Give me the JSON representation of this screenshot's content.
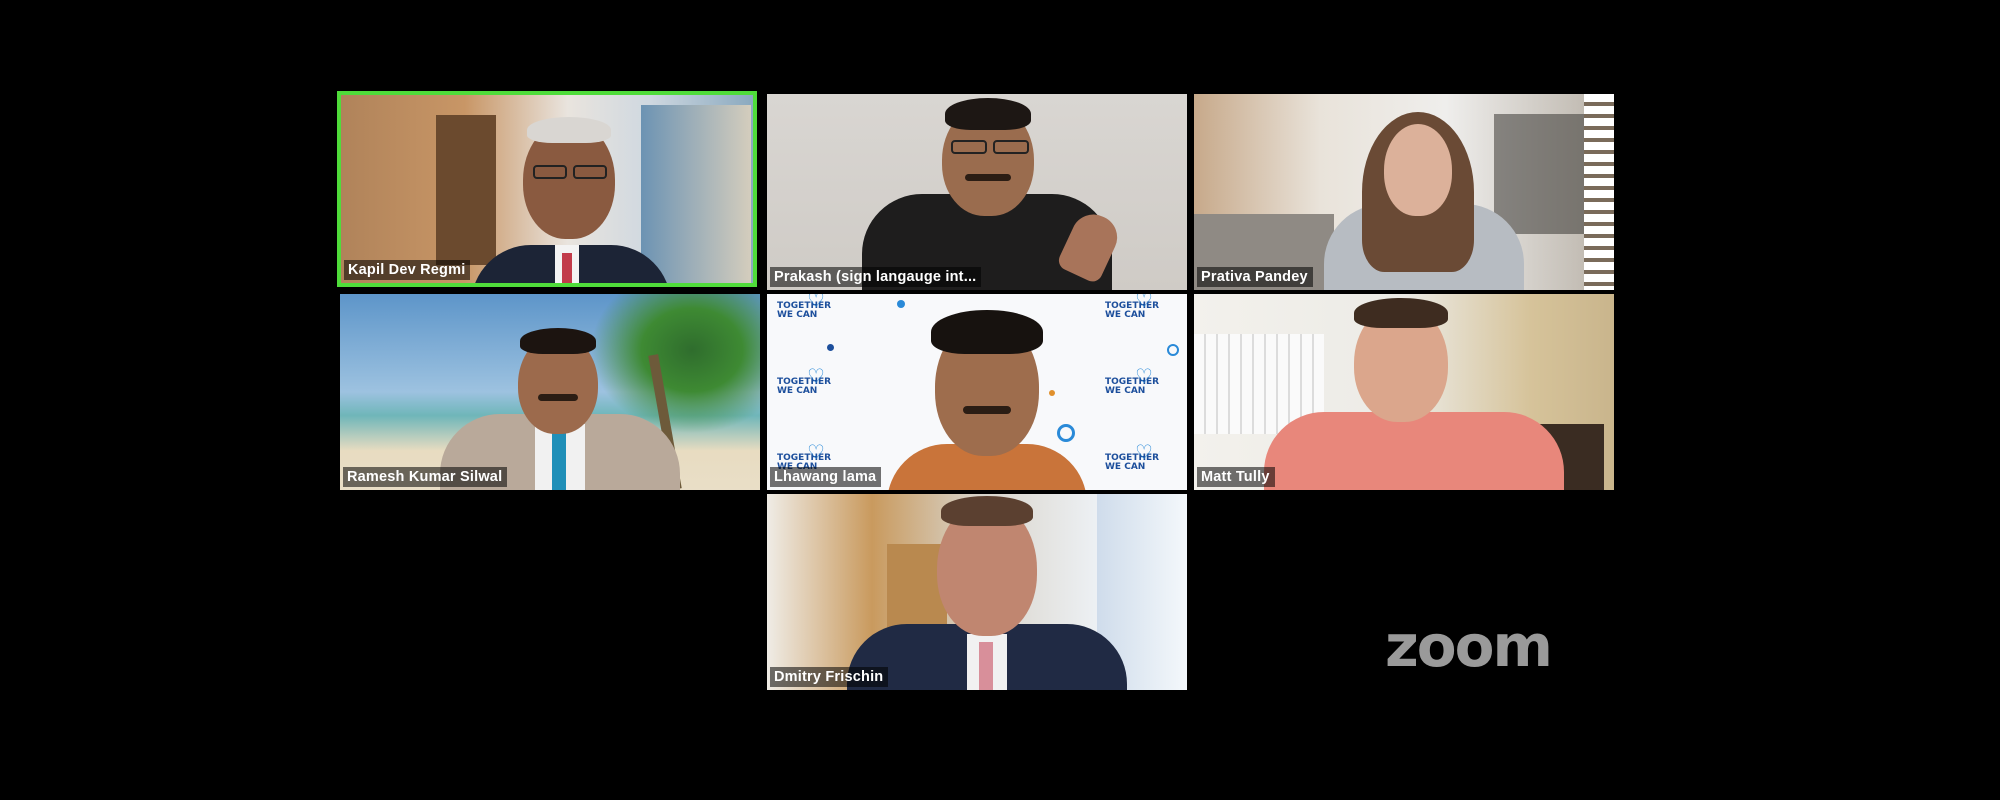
{
  "app": {
    "logo_text": "zoom"
  },
  "participants": [
    {
      "name": "Kapil Dev Regmi",
      "active": true
    },
    {
      "name": "Prakash (sign langauge int...",
      "active": false
    },
    {
      "name": "Prativa Pandey",
      "active": false
    },
    {
      "name": "Ramesh Kumar Silwal",
      "active": false
    },
    {
      "name": "Lhawang lama",
      "active": false
    },
    {
      "name": "Matt Tully",
      "active": false
    },
    {
      "name": "Dmitry Frischin",
      "active": false
    }
  ],
  "background_text": {
    "together_we_can": "TOGETHER WE CAN"
  },
  "colors": {
    "active_speaker_border": "#4fdc3a",
    "background": "#000000",
    "name_label_bg": "rgba(0,0,0,0.55)"
  }
}
